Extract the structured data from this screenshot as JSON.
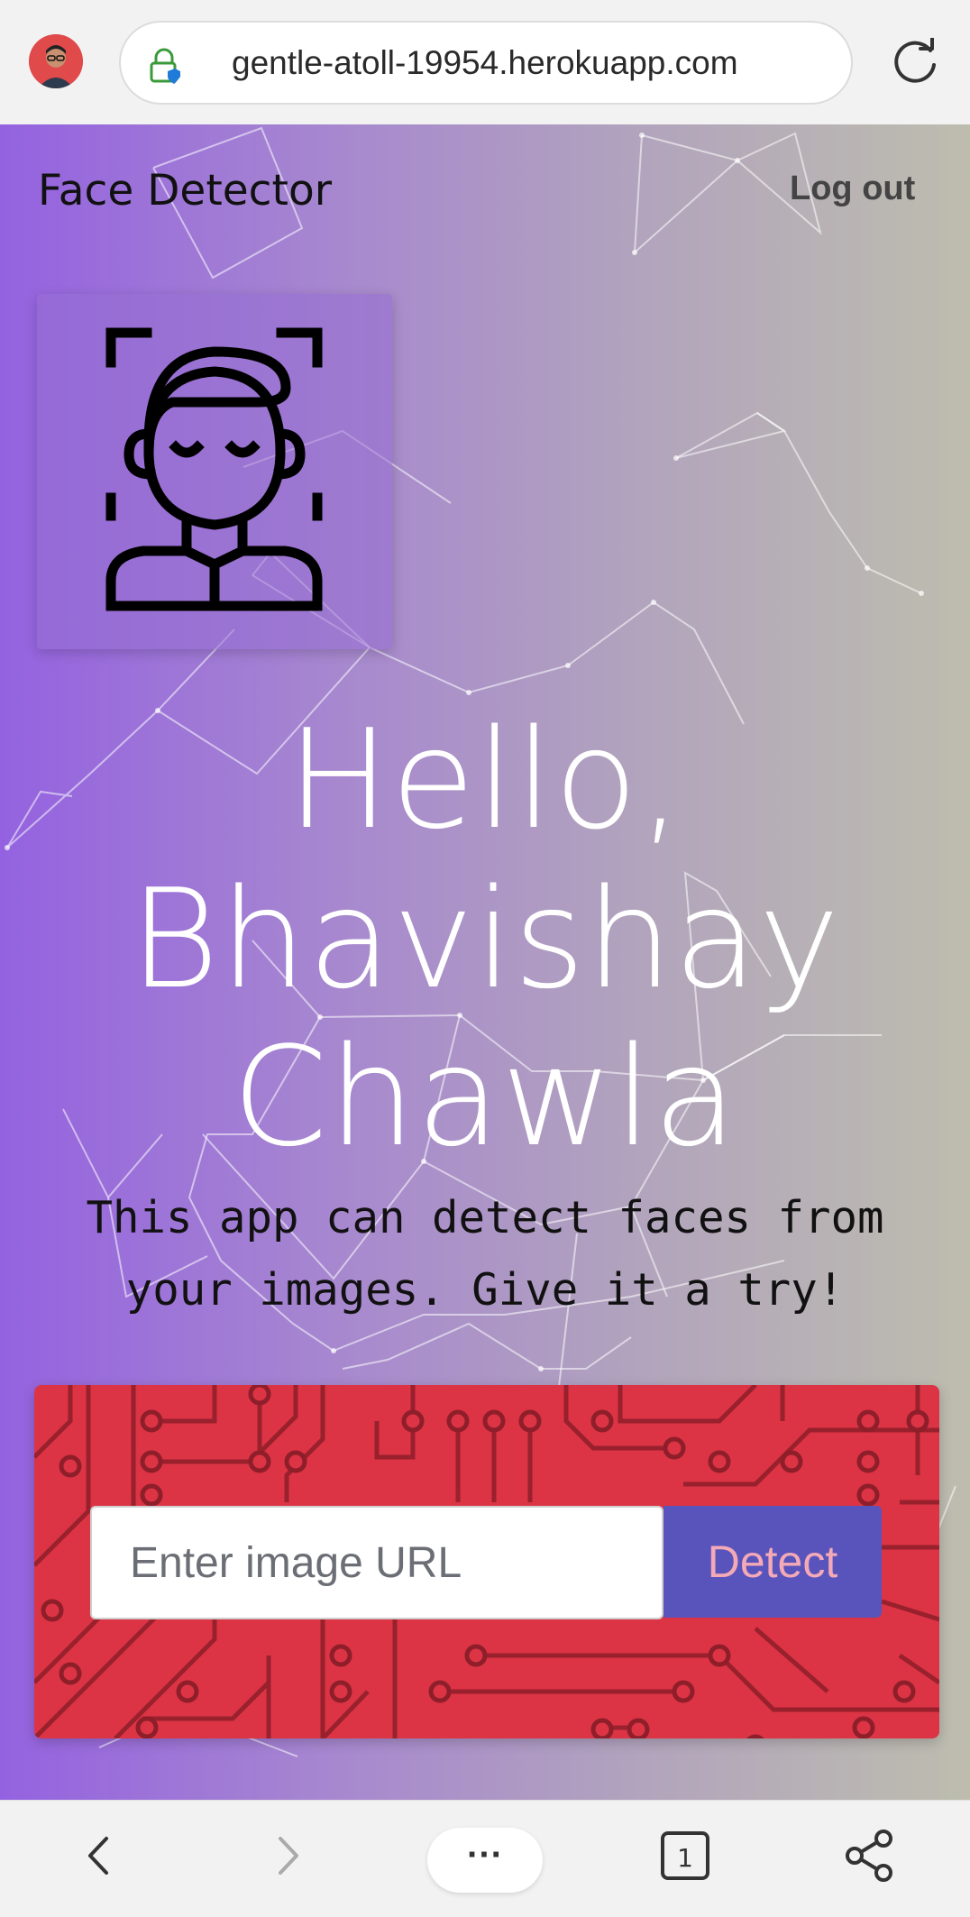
{
  "browser": {
    "url": "gentle-atoll-19954.herokuapp.com",
    "menu_label": "···",
    "tab_count": "1"
  },
  "nav": {
    "brand": "Face Detector",
    "logout_label": "Log out"
  },
  "hero": {
    "line1": "Hello,",
    "line2": "Bhavishay",
    "line3": "Chawla"
  },
  "description": {
    "line1": "This app can detect faces from",
    "line2": "your images. Give it a try!"
  },
  "form": {
    "input_value": "",
    "input_placeholder": "Enter image URL",
    "detect_label": "Detect"
  },
  "colors": {
    "card_red": "#dc3444",
    "detect_blue": "#3c5ad7",
    "gradient_start": "#9462e0",
    "gradient_end": "#bdbdae"
  },
  "icons": {
    "avatar": "avatar-icon",
    "lock": "lock-icon",
    "reload": "reload-icon",
    "logo": "face-scan-icon",
    "back": "chevron-left-icon",
    "forward": "chevron-right-icon",
    "tabs": "tabs-icon",
    "share": "share-icon"
  }
}
